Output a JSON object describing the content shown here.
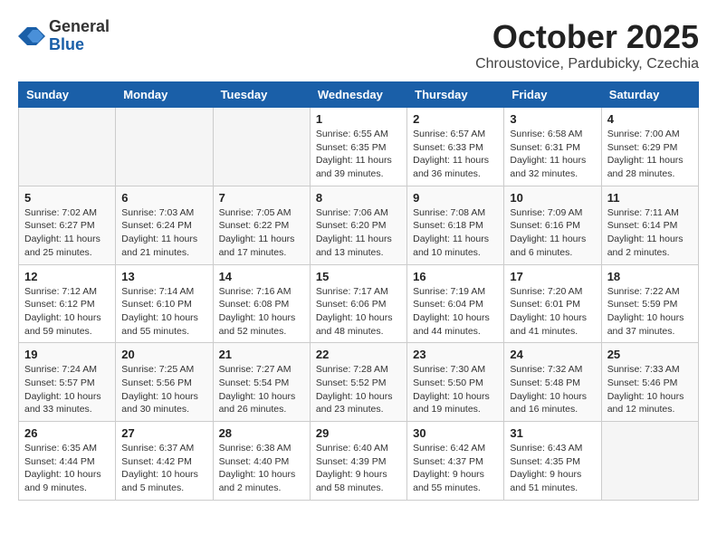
{
  "header": {
    "logo_general": "General",
    "logo_blue": "Blue",
    "month_title": "October 2025",
    "subtitle": "Chroustovice, Pardubicky, Czechia"
  },
  "weekdays": [
    "Sunday",
    "Monday",
    "Tuesday",
    "Wednesday",
    "Thursday",
    "Friday",
    "Saturday"
  ],
  "weeks": [
    [
      {
        "day": "",
        "info": ""
      },
      {
        "day": "",
        "info": ""
      },
      {
        "day": "",
        "info": ""
      },
      {
        "day": "1",
        "info": "Sunrise: 6:55 AM\nSunset: 6:35 PM\nDaylight: 11 hours\nand 39 minutes."
      },
      {
        "day": "2",
        "info": "Sunrise: 6:57 AM\nSunset: 6:33 PM\nDaylight: 11 hours\nand 36 minutes."
      },
      {
        "day": "3",
        "info": "Sunrise: 6:58 AM\nSunset: 6:31 PM\nDaylight: 11 hours\nand 32 minutes."
      },
      {
        "day": "4",
        "info": "Sunrise: 7:00 AM\nSunset: 6:29 PM\nDaylight: 11 hours\nand 28 minutes."
      }
    ],
    [
      {
        "day": "5",
        "info": "Sunrise: 7:02 AM\nSunset: 6:27 PM\nDaylight: 11 hours\nand 25 minutes."
      },
      {
        "day": "6",
        "info": "Sunrise: 7:03 AM\nSunset: 6:24 PM\nDaylight: 11 hours\nand 21 minutes."
      },
      {
        "day": "7",
        "info": "Sunrise: 7:05 AM\nSunset: 6:22 PM\nDaylight: 11 hours\nand 17 minutes."
      },
      {
        "day": "8",
        "info": "Sunrise: 7:06 AM\nSunset: 6:20 PM\nDaylight: 11 hours\nand 13 minutes."
      },
      {
        "day": "9",
        "info": "Sunrise: 7:08 AM\nSunset: 6:18 PM\nDaylight: 11 hours\nand 10 minutes."
      },
      {
        "day": "10",
        "info": "Sunrise: 7:09 AM\nSunset: 6:16 PM\nDaylight: 11 hours\nand 6 minutes."
      },
      {
        "day": "11",
        "info": "Sunrise: 7:11 AM\nSunset: 6:14 PM\nDaylight: 11 hours\nand 2 minutes."
      }
    ],
    [
      {
        "day": "12",
        "info": "Sunrise: 7:12 AM\nSunset: 6:12 PM\nDaylight: 10 hours\nand 59 minutes."
      },
      {
        "day": "13",
        "info": "Sunrise: 7:14 AM\nSunset: 6:10 PM\nDaylight: 10 hours\nand 55 minutes."
      },
      {
        "day": "14",
        "info": "Sunrise: 7:16 AM\nSunset: 6:08 PM\nDaylight: 10 hours\nand 52 minutes."
      },
      {
        "day": "15",
        "info": "Sunrise: 7:17 AM\nSunset: 6:06 PM\nDaylight: 10 hours\nand 48 minutes."
      },
      {
        "day": "16",
        "info": "Sunrise: 7:19 AM\nSunset: 6:04 PM\nDaylight: 10 hours\nand 44 minutes."
      },
      {
        "day": "17",
        "info": "Sunrise: 7:20 AM\nSunset: 6:01 PM\nDaylight: 10 hours\nand 41 minutes."
      },
      {
        "day": "18",
        "info": "Sunrise: 7:22 AM\nSunset: 5:59 PM\nDaylight: 10 hours\nand 37 minutes."
      }
    ],
    [
      {
        "day": "19",
        "info": "Sunrise: 7:24 AM\nSunset: 5:57 PM\nDaylight: 10 hours\nand 33 minutes."
      },
      {
        "day": "20",
        "info": "Sunrise: 7:25 AM\nSunset: 5:56 PM\nDaylight: 10 hours\nand 30 minutes."
      },
      {
        "day": "21",
        "info": "Sunrise: 7:27 AM\nSunset: 5:54 PM\nDaylight: 10 hours\nand 26 minutes."
      },
      {
        "day": "22",
        "info": "Sunrise: 7:28 AM\nSunset: 5:52 PM\nDaylight: 10 hours\nand 23 minutes."
      },
      {
        "day": "23",
        "info": "Sunrise: 7:30 AM\nSunset: 5:50 PM\nDaylight: 10 hours\nand 19 minutes."
      },
      {
        "day": "24",
        "info": "Sunrise: 7:32 AM\nSunset: 5:48 PM\nDaylight: 10 hours\nand 16 minutes."
      },
      {
        "day": "25",
        "info": "Sunrise: 7:33 AM\nSunset: 5:46 PM\nDaylight: 10 hours\nand 12 minutes."
      }
    ],
    [
      {
        "day": "26",
        "info": "Sunrise: 6:35 AM\nSunset: 4:44 PM\nDaylight: 10 hours\nand 9 minutes."
      },
      {
        "day": "27",
        "info": "Sunrise: 6:37 AM\nSunset: 4:42 PM\nDaylight: 10 hours\nand 5 minutes."
      },
      {
        "day": "28",
        "info": "Sunrise: 6:38 AM\nSunset: 4:40 PM\nDaylight: 10 hours\nand 2 minutes."
      },
      {
        "day": "29",
        "info": "Sunrise: 6:40 AM\nSunset: 4:39 PM\nDaylight: 9 hours\nand 58 minutes."
      },
      {
        "day": "30",
        "info": "Sunrise: 6:42 AM\nSunset: 4:37 PM\nDaylight: 9 hours\nand 55 minutes."
      },
      {
        "day": "31",
        "info": "Sunrise: 6:43 AM\nSunset: 4:35 PM\nDaylight: 9 hours\nand 51 minutes."
      },
      {
        "day": "",
        "info": ""
      }
    ]
  ]
}
